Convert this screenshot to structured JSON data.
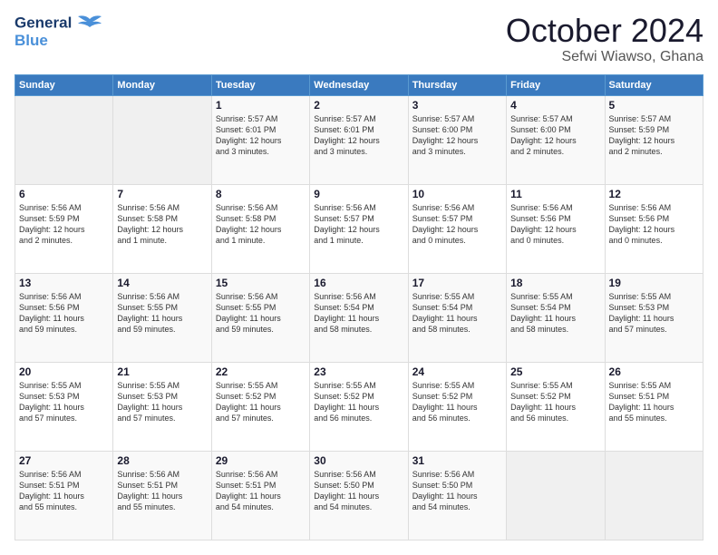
{
  "logo": {
    "line1": "General",
    "line2": "Blue"
  },
  "title": "October 2024",
  "subtitle": "Sefwi Wiawso, Ghana",
  "days_header": [
    "Sunday",
    "Monday",
    "Tuesday",
    "Wednesday",
    "Thursday",
    "Friday",
    "Saturday"
  ],
  "weeks": [
    [
      {
        "day": "",
        "info": ""
      },
      {
        "day": "",
        "info": ""
      },
      {
        "day": "1",
        "info": "Sunrise: 5:57 AM\nSunset: 6:01 PM\nDaylight: 12 hours\nand 3 minutes."
      },
      {
        "day": "2",
        "info": "Sunrise: 5:57 AM\nSunset: 6:01 PM\nDaylight: 12 hours\nand 3 minutes."
      },
      {
        "day": "3",
        "info": "Sunrise: 5:57 AM\nSunset: 6:00 PM\nDaylight: 12 hours\nand 3 minutes."
      },
      {
        "day": "4",
        "info": "Sunrise: 5:57 AM\nSunset: 6:00 PM\nDaylight: 12 hours\nand 2 minutes."
      },
      {
        "day": "5",
        "info": "Sunrise: 5:57 AM\nSunset: 5:59 PM\nDaylight: 12 hours\nand 2 minutes."
      }
    ],
    [
      {
        "day": "6",
        "info": "Sunrise: 5:56 AM\nSunset: 5:59 PM\nDaylight: 12 hours\nand 2 minutes."
      },
      {
        "day": "7",
        "info": "Sunrise: 5:56 AM\nSunset: 5:58 PM\nDaylight: 12 hours\nand 1 minute."
      },
      {
        "day": "8",
        "info": "Sunrise: 5:56 AM\nSunset: 5:58 PM\nDaylight: 12 hours\nand 1 minute."
      },
      {
        "day": "9",
        "info": "Sunrise: 5:56 AM\nSunset: 5:57 PM\nDaylight: 12 hours\nand 1 minute."
      },
      {
        "day": "10",
        "info": "Sunrise: 5:56 AM\nSunset: 5:57 PM\nDaylight: 12 hours\nand 0 minutes."
      },
      {
        "day": "11",
        "info": "Sunrise: 5:56 AM\nSunset: 5:56 PM\nDaylight: 12 hours\nand 0 minutes."
      },
      {
        "day": "12",
        "info": "Sunrise: 5:56 AM\nSunset: 5:56 PM\nDaylight: 12 hours\nand 0 minutes."
      }
    ],
    [
      {
        "day": "13",
        "info": "Sunrise: 5:56 AM\nSunset: 5:56 PM\nDaylight: 11 hours\nand 59 minutes."
      },
      {
        "day": "14",
        "info": "Sunrise: 5:56 AM\nSunset: 5:55 PM\nDaylight: 11 hours\nand 59 minutes."
      },
      {
        "day": "15",
        "info": "Sunrise: 5:56 AM\nSunset: 5:55 PM\nDaylight: 11 hours\nand 59 minutes."
      },
      {
        "day": "16",
        "info": "Sunrise: 5:56 AM\nSunset: 5:54 PM\nDaylight: 11 hours\nand 58 minutes."
      },
      {
        "day": "17",
        "info": "Sunrise: 5:55 AM\nSunset: 5:54 PM\nDaylight: 11 hours\nand 58 minutes."
      },
      {
        "day": "18",
        "info": "Sunrise: 5:55 AM\nSunset: 5:54 PM\nDaylight: 11 hours\nand 58 minutes."
      },
      {
        "day": "19",
        "info": "Sunrise: 5:55 AM\nSunset: 5:53 PM\nDaylight: 11 hours\nand 57 minutes."
      }
    ],
    [
      {
        "day": "20",
        "info": "Sunrise: 5:55 AM\nSunset: 5:53 PM\nDaylight: 11 hours\nand 57 minutes."
      },
      {
        "day": "21",
        "info": "Sunrise: 5:55 AM\nSunset: 5:53 PM\nDaylight: 11 hours\nand 57 minutes."
      },
      {
        "day": "22",
        "info": "Sunrise: 5:55 AM\nSunset: 5:52 PM\nDaylight: 11 hours\nand 57 minutes."
      },
      {
        "day": "23",
        "info": "Sunrise: 5:55 AM\nSunset: 5:52 PM\nDaylight: 11 hours\nand 56 minutes."
      },
      {
        "day": "24",
        "info": "Sunrise: 5:55 AM\nSunset: 5:52 PM\nDaylight: 11 hours\nand 56 minutes."
      },
      {
        "day": "25",
        "info": "Sunrise: 5:55 AM\nSunset: 5:52 PM\nDaylight: 11 hours\nand 56 minutes."
      },
      {
        "day": "26",
        "info": "Sunrise: 5:55 AM\nSunset: 5:51 PM\nDaylight: 11 hours\nand 55 minutes."
      }
    ],
    [
      {
        "day": "27",
        "info": "Sunrise: 5:56 AM\nSunset: 5:51 PM\nDaylight: 11 hours\nand 55 minutes."
      },
      {
        "day": "28",
        "info": "Sunrise: 5:56 AM\nSunset: 5:51 PM\nDaylight: 11 hours\nand 55 minutes."
      },
      {
        "day": "29",
        "info": "Sunrise: 5:56 AM\nSunset: 5:51 PM\nDaylight: 11 hours\nand 54 minutes."
      },
      {
        "day": "30",
        "info": "Sunrise: 5:56 AM\nSunset: 5:50 PM\nDaylight: 11 hours\nand 54 minutes."
      },
      {
        "day": "31",
        "info": "Sunrise: 5:56 AM\nSunset: 5:50 PM\nDaylight: 11 hours\nand 54 minutes."
      },
      {
        "day": "",
        "info": ""
      },
      {
        "day": "",
        "info": ""
      }
    ]
  ]
}
